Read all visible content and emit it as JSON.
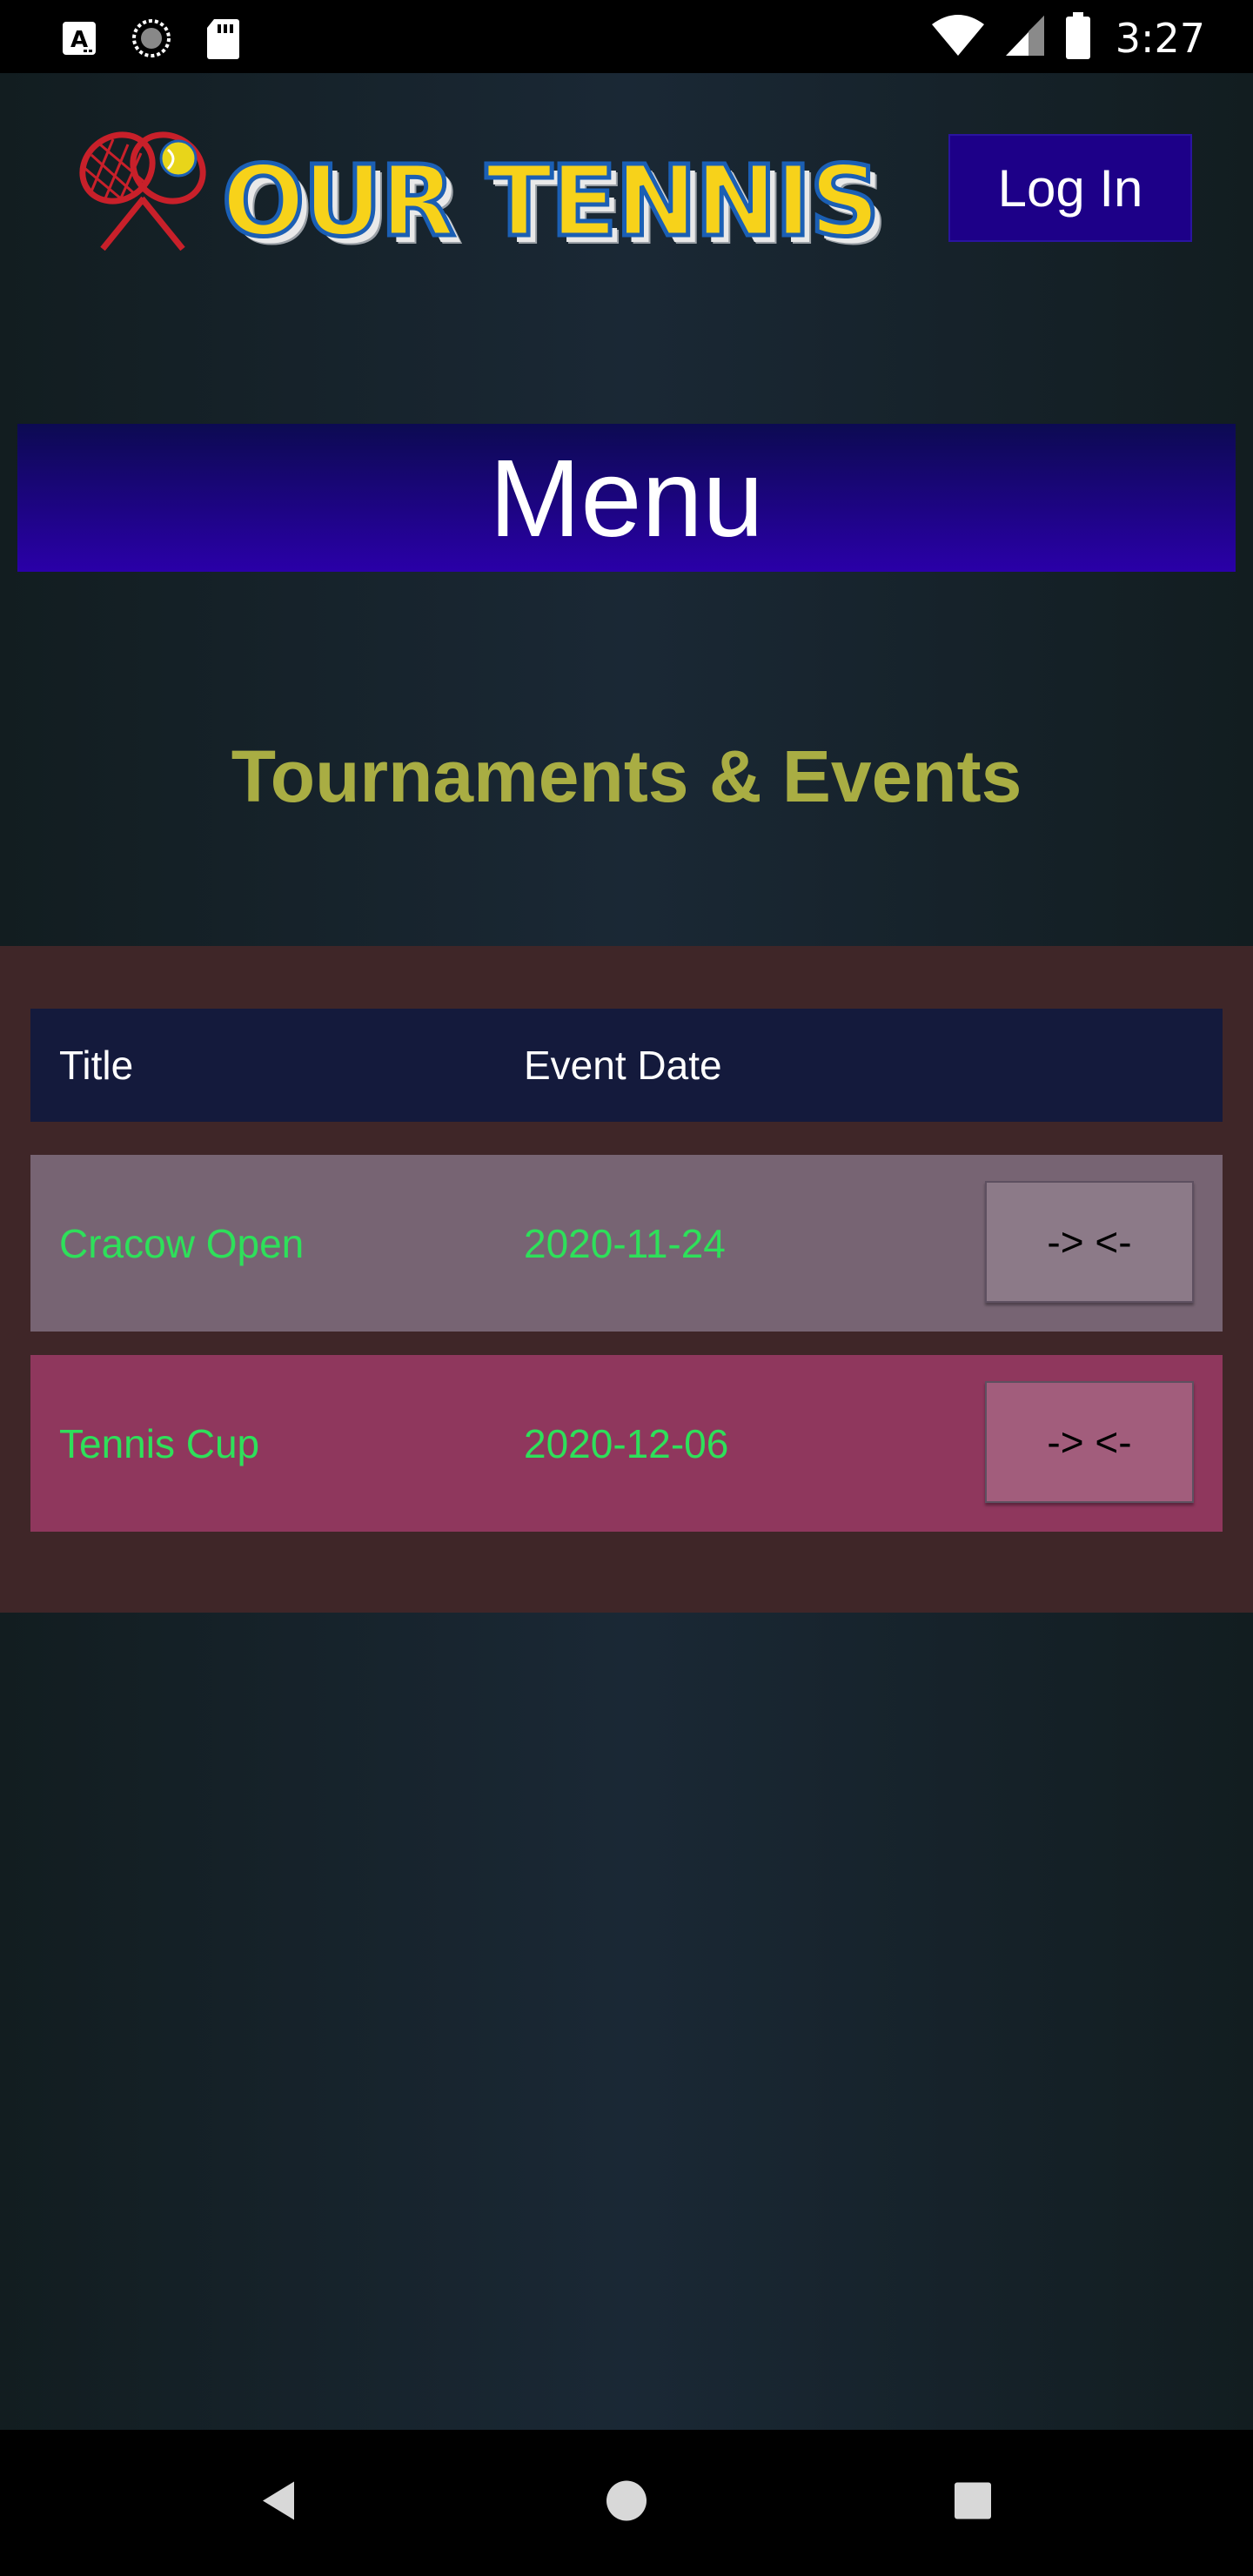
{
  "status_bar": {
    "time": "3:27",
    "icons": [
      "a-notification-icon",
      "sync-icon",
      "sd-card-icon",
      "wifi-icon",
      "cell-signal-icon",
      "battery-icon"
    ]
  },
  "header": {
    "logo_text": "OUR TENNIS",
    "login_label": "Log In"
  },
  "menu": {
    "label": "Menu"
  },
  "section": {
    "title": "Tournaments & Events"
  },
  "table": {
    "headers": [
      "Title",
      "Event Date"
    ],
    "rows": [
      {
        "title": "Cracow Open",
        "date": "2020-11-24",
        "action_label": "-> <-"
      },
      {
        "title": "Tennis Cup",
        "date": "2020-12-06",
        "action_label": "-> <-"
      }
    ]
  },
  "colors": {
    "accent_button": "#1d0088",
    "section_title": "#a9ad43",
    "row_text": "#2ee05a",
    "panel_bg": "#3f2628",
    "row_1_bg": "#776473",
    "row_2_bg": "#8f375d",
    "table_header_bg": "#141a3c"
  },
  "nav_bar": {
    "icons": [
      "back-icon",
      "home-icon",
      "recents-icon"
    ]
  }
}
